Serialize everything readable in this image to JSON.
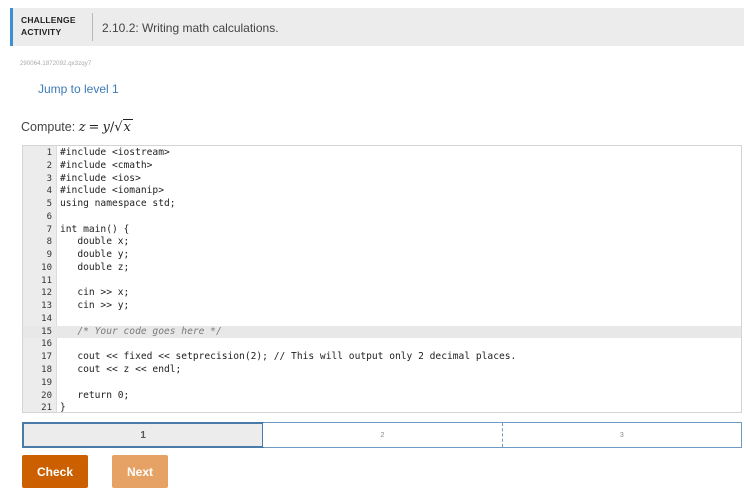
{
  "header": {
    "badge_line1": "CHALLENGE",
    "badge_line2": "ACTIVITY",
    "title": "2.10.2: Writing math calculations."
  },
  "activity_id": "290064.1872092.qx3zqy7",
  "jump_link": "Jump to level 1",
  "prompt": {
    "label": "Compute:",
    "lhs": "z",
    "equals": "=",
    "numerator": "y",
    "slash": "/",
    "radical": "√",
    "radicand": "x"
  },
  "code_lines": [
    {
      "num": "1",
      "text": "#include <iostream>"
    },
    {
      "num": "2",
      "text": "#include <cmath>"
    },
    {
      "num": "3",
      "text": "#include <ios>"
    },
    {
      "num": "4",
      "text": "#include <iomanip>"
    },
    {
      "num": "5",
      "text": "using namespace std;"
    },
    {
      "num": "6",
      "text": ""
    },
    {
      "num": "7",
      "text": "int main() {"
    },
    {
      "num": "8",
      "text": "   double x;"
    },
    {
      "num": "9",
      "text": "   double y;"
    },
    {
      "num": "10",
      "text": "   double z;"
    },
    {
      "num": "11",
      "text": ""
    },
    {
      "num": "12",
      "text": "   cin >> x;"
    },
    {
      "num": "13",
      "text": "   cin >> y;"
    },
    {
      "num": "14",
      "text": ""
    },
    {
      "num": "15",
      "text": "   /* Your code goes here */"
    },
    {
      "num": "16",
      "text": ""
    },
    {
      "num": "17",
      "text": "   cout << fixed << setprecision(2); // This will output only 2 decimal places."
    },
    {
      "num": "18",
      "text": "   cout << z << endl;"
    },
    {
      "num": "19",
      "text": ""
    },
    {
      "num": "20",
      "text": "   return 0;"
    },
    {
      "num": "21",
      "text": "}"
    }
  ],
  "levels": [
    {
      "label": "1"
    },
    {
      "label": "2"
    },
    {
      "label": "3"
    }
  ],
  "buttons": {
    "check": "Check",
    "next": "Next"
  },
  "colors": {
    "accent_blue": "#3f8fd0",
    "check_orange": "#cc6000",
    "next_orange": "#e6a264",
    "link_blue": "#3d7ab8"
  }
}
